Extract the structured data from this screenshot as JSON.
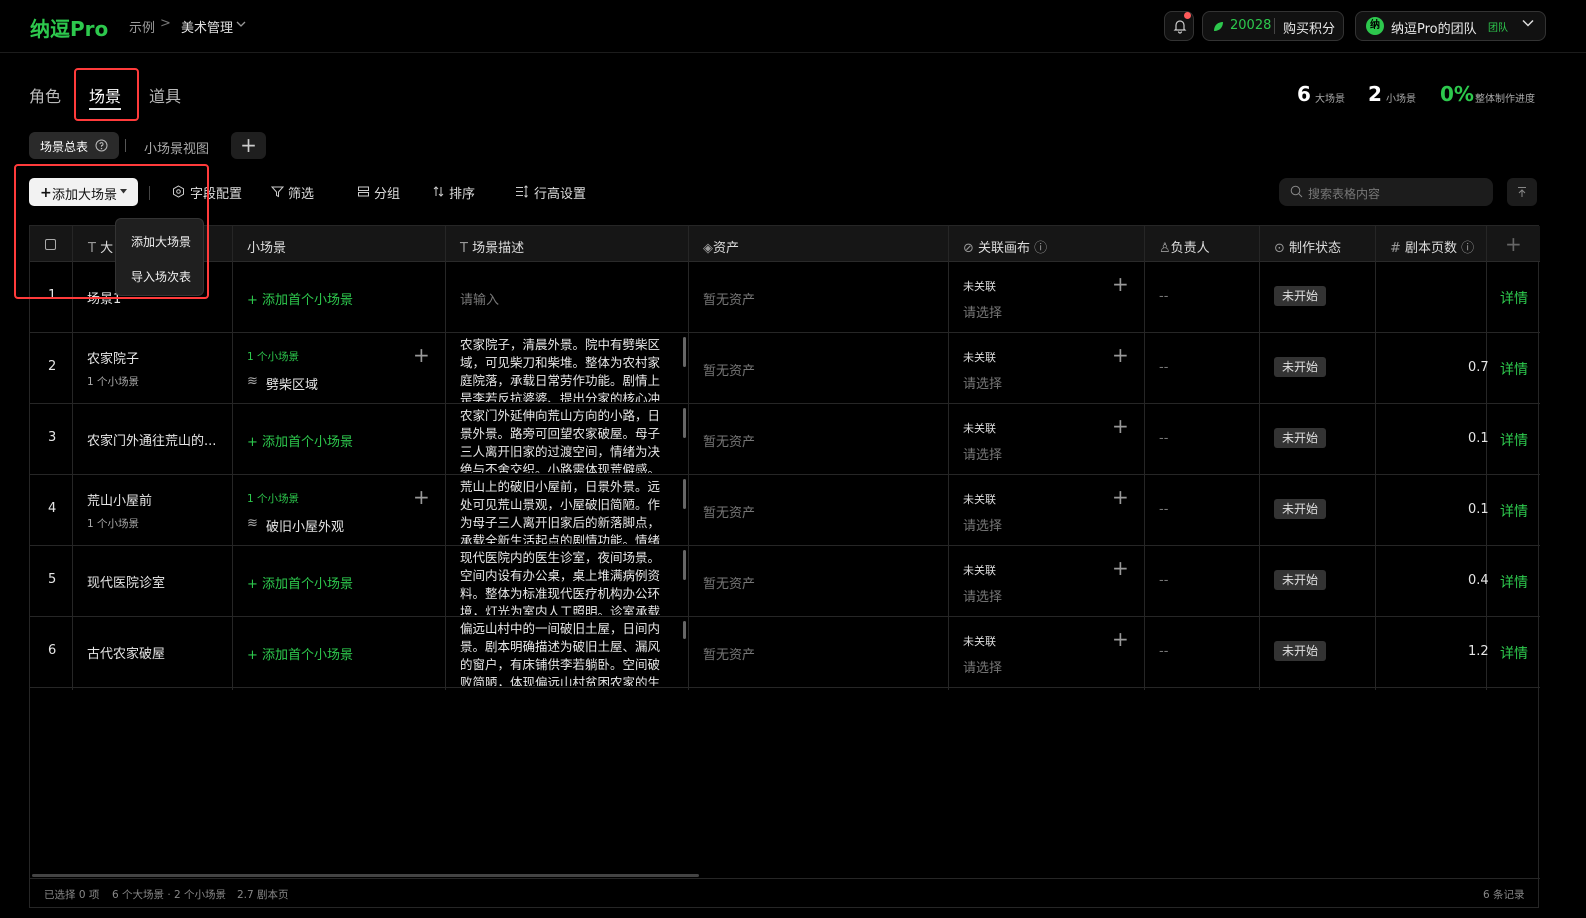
{
  "header": {
    "logo": "纳逗Pro",
    "breadcrumb": [
      "示例",
      "美术管理"
    ],
    "breadcrumb_sep": ">",
    "points": "20028",
    "buy_label": "购买积分",
    "team_avatar": "纳",
    "team_name": "纳逗Pro的团队",
    "team_badge": "团队"
  },
  "tabs": [
    "角色",
    "场景",
    "道具"
  ],
  "active_tab": "场景",
  "stats": {
    "big_count": "6",
    "big_label": "大场景",
    "small_count": "2",
    "small_label": "小场景",
    "progress": "0%",
    "progress_label": "整体制作进度"
  },
  "views": {
    "active": "场景总表",
    "other": "小场景视图",
    "add": "+"
  },
  "toolbar": {
    "add_label": "添加大场景",
    "field_config": "字段配置",
    "filter": "筛选",
    "group": "分组",
    "sort": "排序",
    "row_height": "行高设置",
    "search_placeholder": "搜索表格内容"
  },
  "dropdown": [
    "添加大场景",
    "导入场次表"
  ],
  "columns": {
    "big": "大",
    "small": "小场景",
    "desc": "场景描述",
    "asset": "资产",
    "canvas": "关联画布",
    "owner": "负责人",
    "status": "制作状态",
    "pages": "剧本页数"
  },
  "rows": [
    {
      "no": "1",
      "name": "场景1",
      "sub": "",
      "small_add": "+ 添加首个小场景",
      "small_count": "",
      "small_item": "",
      "desc": "请输入",
      "asset": "暂无资产",
      "canvas_status": "未关联",
      "canvas_pick": "请选择",
      "owner": "--",
      "status": "未开始",
      "pages": "",
      "detail": "详情"
    },
    {
      "no": "2",
      "name": "农家院子",
      "sub": "1 个小场景",
      "small_add": "",
      "small_count": "1 个小场景",
      "small_item": "劈柴区域",
      "desc": "农家院子，清晨外景。院中有劈柴区域，可见柴刀和柴堆。整体为农村家庭院落，承载日常劳作功能。剧情上是李若反抗婆婆、提出分家的核心冲突场景。",
      "asset": "暂无资产",
      "canvas_status": "未关联",
      "canvas_pick": "请选择",
      "owner": "--",
      "status": "未开始",
      "pages": "0.7",
      "detail": "详情"
    },
    {
      "no": "3",
      "name": "农家门外通往荒山的...",
      "sub": "",
      "small_add": "+ 添加首个小场景",
      "small_count": "",
      "small_item": "",
      "desc": "农家门外延伸向荒山方向的小路，日景外景。路旁可回望农家破屋。母子三人离开旧家的过渡空间，情绪为决绝与不舍交织。小路需体现荒僻感。",
      "asset": "暂无资产",
      "canvas_status": "未关联",
      "canvas_pick": "请选择",
      "owner": "--",
      "status": "未开始",
      "pages": "0.1",
      "detail": "详情"
    },
    {
      "no": "4",
      "name": "荒山小屋前",
      "sub": "1 个小场景",
      "small_add": "",
      "small_count": "1 个小场景",
      "small_item": "破旧小屋外观",
      "desc": "荒山上的破旧小屋前，日景外景。远处可见荒山景观，小屋破旧简陋。作为母子三人离开旧家后的新落脚点，承载全新生活起点的剧情功能。情绪",
      "asset": "暂无资产",
      "canvas_status": "未关联",
      "canvas_pick": "请选择",
      "owner": "--",
      "status": "未开始",
      "pages": "0.1",
      "detail": "详情"
    },
    {
      "no": "5",
      "name": "现代医院诊室",
      "sub": "",
      "small_add": "+ 添加首个小场景",
      "small_count": "",
      "small_item": "",
      "desc": "现代医院内的医生诊室，夜间场景。空间内设有办公桌，桌上堆满病例资料。整体为标准现代医疗机构办公环境，灯光为室内人工照明。诊室承载",
      "asset": "暂无资产",
      "canvas_status": "未关联",
      "canvas_pick": "请选择",
      "owner": "--",
      "status": "未开始",
      "pages": "0.4",
      "detail": "详情"
    },
    {
      "no": "6",
      "name": "古代农家破屋",
      "sub": "",
      "small_add": "+ 添加首个小场景",
      "small_count": "",
      "small_item": "",
      "desc": "偏远山村中的一间破旧土屋，日间内景。剧本明确描述为破旧土屋、漏风的窗户，有床铺供李若躺卧。空间破败简陋，体现偏远山村贫困农家的生",
      "asset": "暂无资产",
      "canvas_status": "未关联",
      "canvas_pick": "请选择",
      "owner": "--",
      "status": "未开始",
      "pages": "1.2",
      "detail": "详情"
    }
  ],
  "footer": {
    "selected": "已选择 0 项",
    "summary": "6 个大场景 · 2 个小场景",
    "pages": "2.7 剧本页",
    "records": "6 条记录"
  },
  "colors": {
    "accent": "#2dc84d",
    "highlight": "#ff3b3b"
  }
}
